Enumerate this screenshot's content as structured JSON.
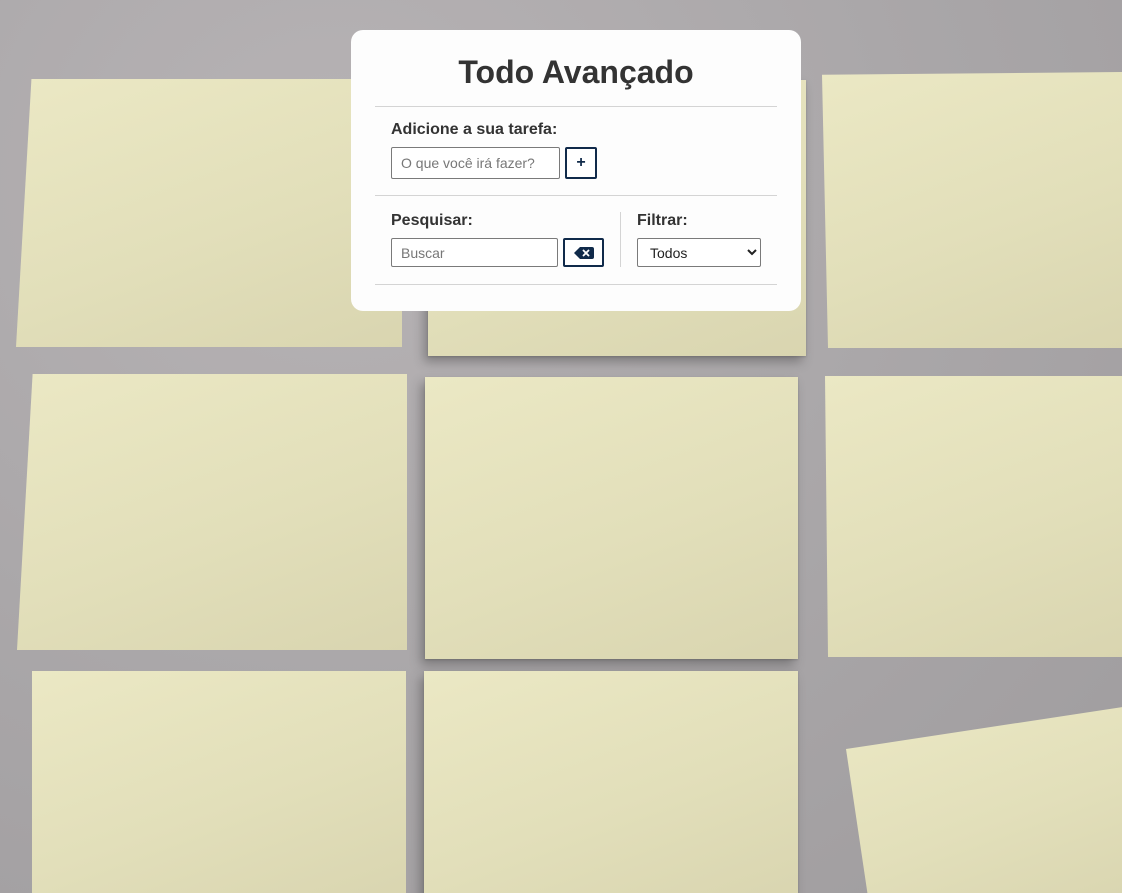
{
  "app": {
    "title": "Todo Avançado"
  },
  "add_task": {
    "label": "Adicione a sua tarefa:",
    "input_placeholder": "O que você irá fazer?",
    "input_value": "",
    "add_button_label": "+"
  },
  "search": {
    "label": "Pesquisar:",
    "input_placeholder": "Buscar",
    "input_value": "",
    "clear_button_icon": "backspace-icon"
  },
  "filter": {
    "label": "Filtrar:",
    "selected": "Todos"
  },
  "colors": {
    "accent": "#102a4a",
    "panel_bg": "#fdfdfd",
    "note_yellow": "#e2dfba",
    "wall_gray": "#a9a6a8"
  },
  "background": {
    "description_icon": "sticky-notes-wall"
  }
}
